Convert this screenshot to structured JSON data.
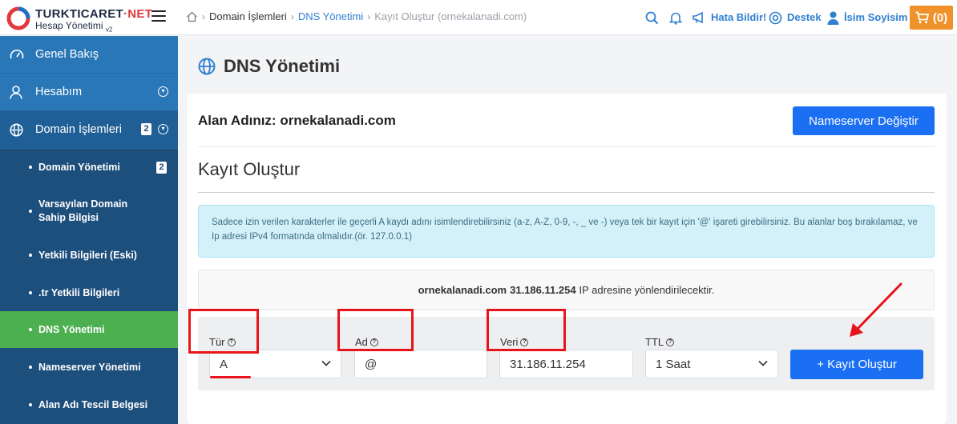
{
  "app": {
    "brand_main": "TURKTICARET",
    "brand_dot": "·",
    "brand_net": "NET",
    "subtitle": "Hesap Yönetimi",
    "version": "v2"
  },
  "breadcrumb": {
    "items": [
      "Domain İşlemleri",
      "DNS Yönetimi",
      "Kayıt Oluştur (ornekalanadi.com)"
    ]
  },
  "topbar": {
    "report_label": "Hata Bildir!",
    "support_label": "Destek",
    "user_label": "İsim Soyisim",
    "cart_count": "(0)"
  },
  "sidebar": {
    "main": [
      {
        "label": "Genel Bakış",
        "icon": "gauge-icon"
      },
      {
        "label": "Hesabım",
        "icon": "user-icon"
      },
      {
        "label": "Domain İşlemleri",
        "icon": "globe-icon",
        "badge": "2"
      }
    ],
    "sub": [
      {
        "label": "Domain Yönetimi",
        "badge": "2"
      },
      {
        "label": "Varsayılan Domain Sahip Bilgisi"
      },
      {
        "label": "Yetkili Bilgileri (Eski)"
      },
      {
        "label": ".tr Yetkili Bilgileri"
      },
      {
        "label": "DNS Yönetimi",
        "active": true
      },
      {
        "label": "Nameserver Yönetimi"
      },
      {
        "label": "Alan Adı Tescil Belgesi"
      }
    ]
  },
  "page": {
    "title": "DNS Yönetimi",
    "domain_prefix": "Alan Adınız:",
    "domain": "ornekalanadi.com",
    "nameserver_button": "Nameserver Değiştir",
    "section_title": "Kayıt Oluştur",
    "info_text": "Sadece izin verilen karakterler ile geçerli A kaydı adını isimlendirebilirsiniz (a-z, A-Z, 0-9, -, _ ve -) veya tek bir kayıt için '@' işareti girebilirsiniz. Bu alanlar boş bırakılamaz, ve Ip adresi IPv4 formatında olmalıdır.(ör. 127.0.0.1)",
    "notice_domain": "ornekalanadi.com",
    "notice_ip": "31.186.11.254",
    "notice_suffix": "IP adresine yönlendirilecektir."
  },
  "form": {
    "type_label": "Tür",
    "type_value": "A",
    "name_label": "Ad",
    "name_value": "@",
    "data_label": "Veri",
    "data_value": "31.186.11.254",
    "ttl_label": "TTL",
    "ttl_value": "1 Saat",
    "submit_label": "+ Kayıt Oluştur"
  },
  "colors": {
    "primary_blue": "#1b6ff2",
    "sidebar_blue": "#1d4f7c",
    "active_green": "#4caf50",
    "cart_orange": "#f0922b",
    "annotation_red": "#e8131b"
  }
}
